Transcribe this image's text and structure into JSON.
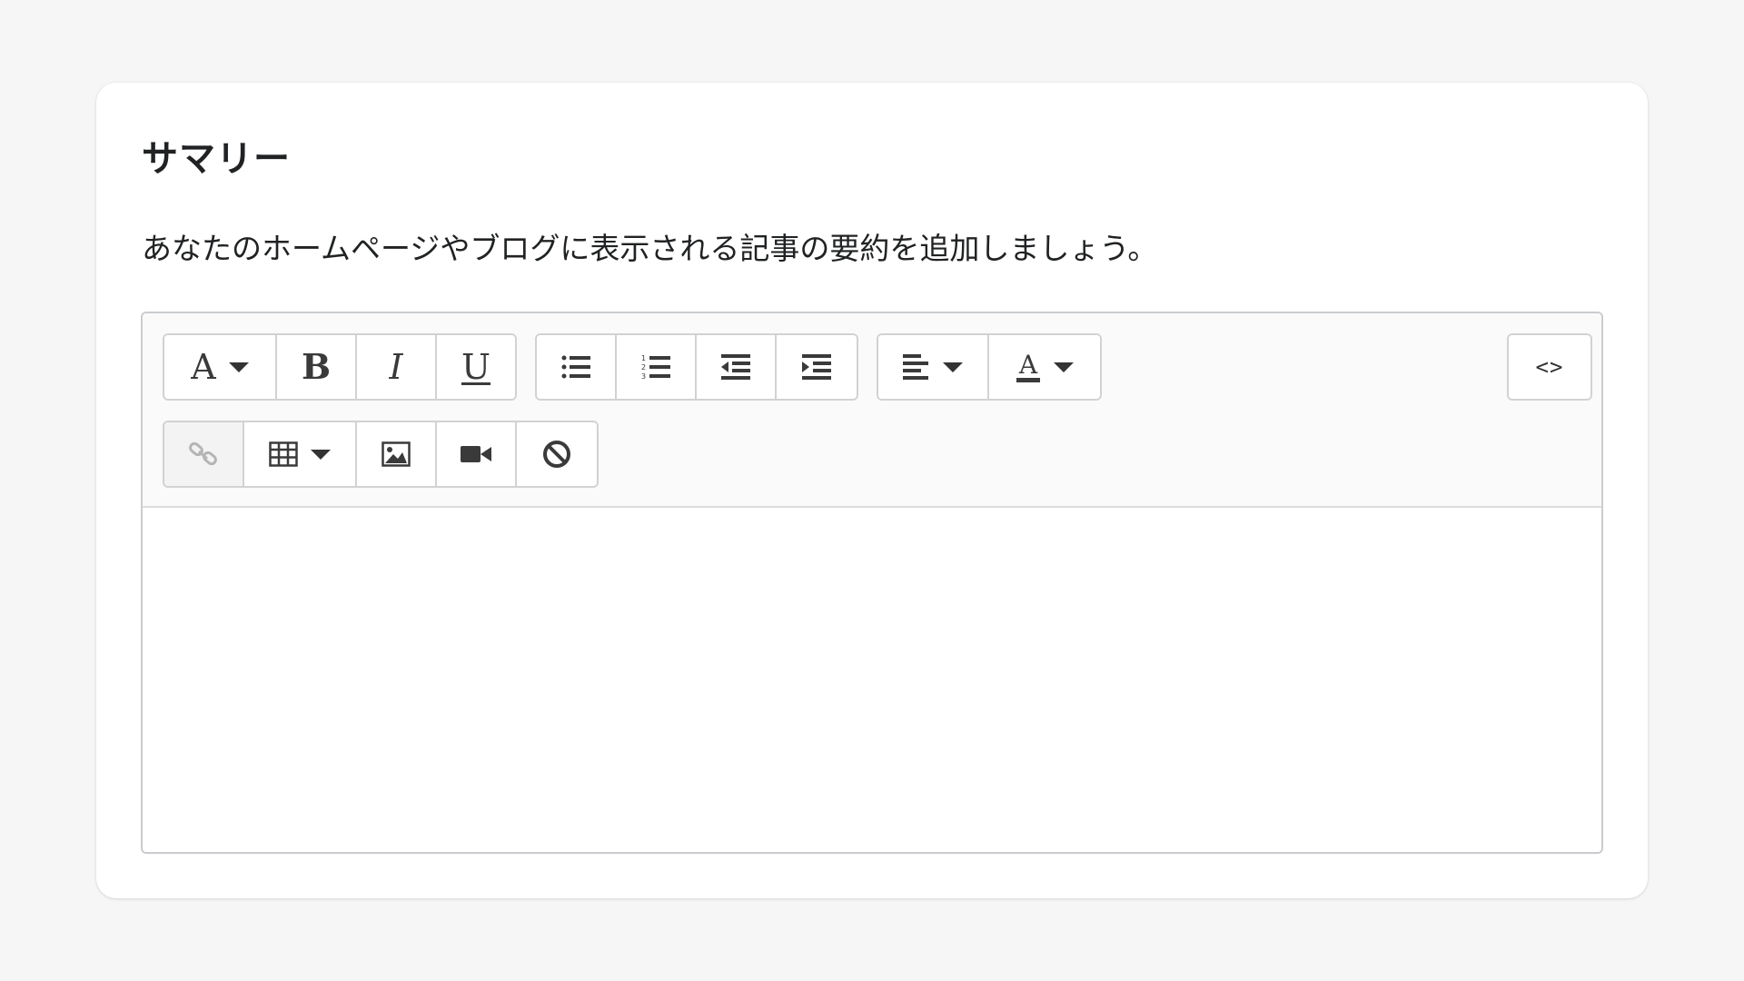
{
  "card": {
    "title": "サマリー",
    "description": "あなたのホームページやブログに表示される記事の要約を追加しましょう。"
  },
  "toolbar": {
    "font_label": "A",
    "bold_label": "B",
    "italic_label": "I",
    "underline_label": "U",
    "code_view_label": "<>"
  },
  "editor": {
    "content": ""
  },
  "colors": {
    "background": "#f6f6f7",
    "card": "#ffffff",
    "toolbar": "#fafafa",
    "border": "#c9cccf",
    "icon": "#3a3a3a",
    "disabled_icon": "#b5b5b5"
  }
}
